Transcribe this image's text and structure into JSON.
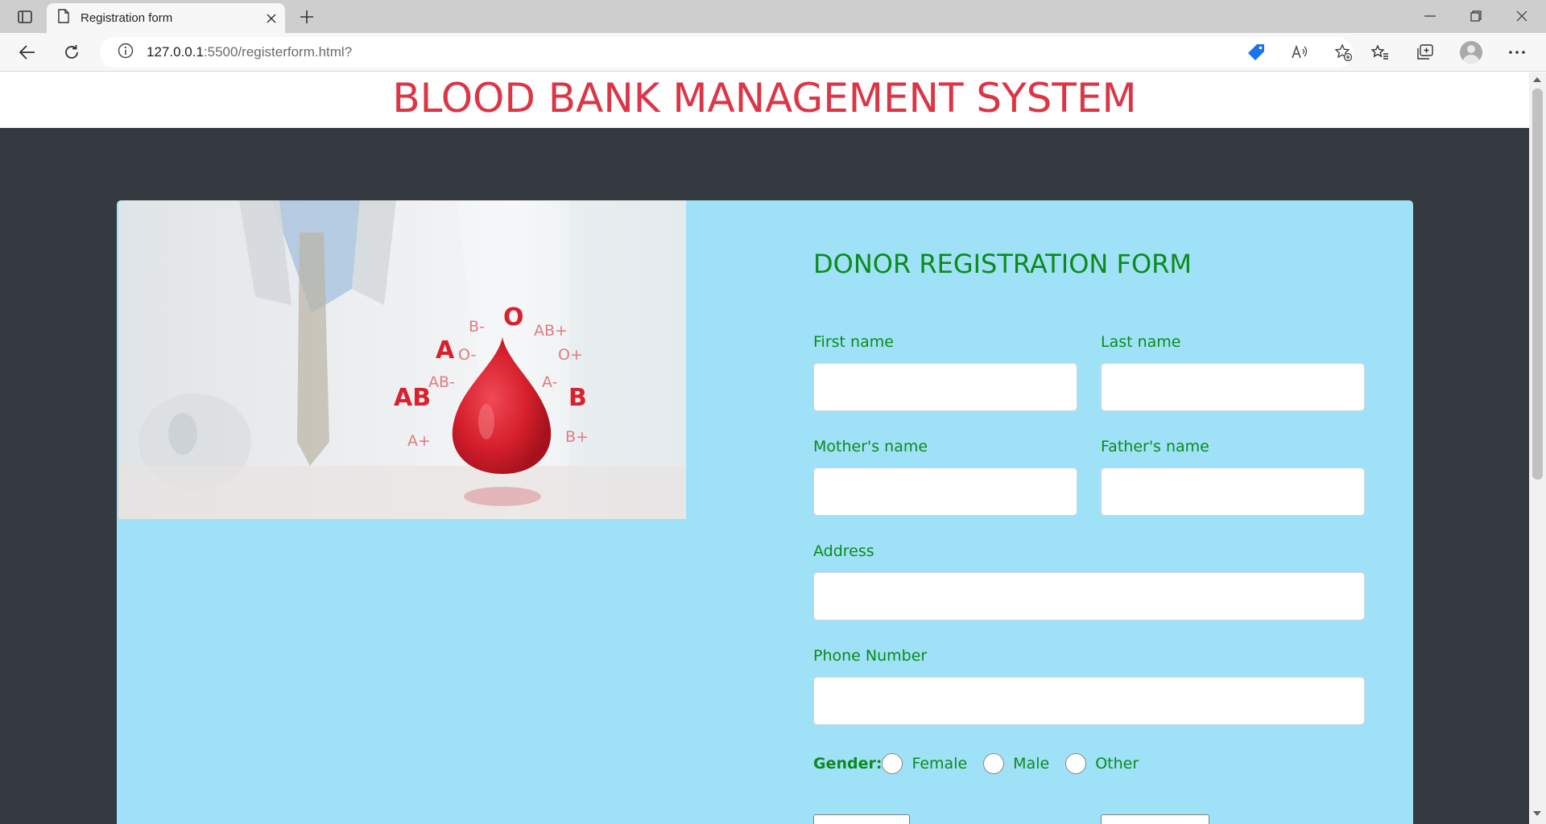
{
  "browser": {
    "tab_title": "Registration form",
    "url_host": "127.0.0.1",
    "url_path": ":5500/registerform.html?"
  },
  "page": {
    "site_title": "BLOOD BANK MANAGEMENT SYSTEM",
    "form_title": "DONOR REGISTRATION FORM",
    "fields": {
      "first_name": {
        "label": "First name",
        "value": ""
      },
      "last_name": {
        "label": "Last name",
        "value": ""
      },
      "mother_name": {
        "label": "Mother's name",
        "value": ""
      },
      "father_name": {
        "label": "Father's name",
        "value": ""
      },
      "address": {
        "label": "Address",
        "value": ""
      },
      "phone": {
        "label": "Phone Number",
        "value": ""
      }
    },
    "gender": {
      "label": "Gender:",
      "options": [
        "Female",
        "Male",
        "Other"
      ]
    },
    "hero_image": {
      "blood_groups": [
        "O",
        "B-",
        "AB+",
        "A",
        "O-",
        "O+",
        "AB-",
        "A-",
        "AB",
        "B",
        "A+",
        "B+"
      ]
    }
  },
  "colors": {
    "title_red": "#dc3545",
    "form_green": "#0c8a1c",
    "card_bg": "#9fe2f7",
    "page_bg": "#343a40",
    "drop_red": "#d61f2c"
  }
}
